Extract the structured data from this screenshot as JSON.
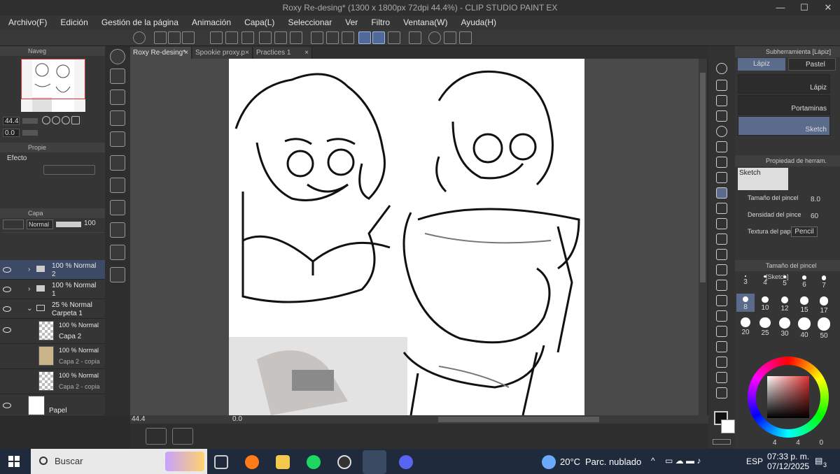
{
  "window": {
    "title": "Roxy Re-desing* (1300 x 1800px 72dpi 44.4%) - CLIP STUDIO PAINT EX",
    "minimize": "—",
    "maximize": "☐",
    "close": "✕"
  },
  "menu": [
    "Archivo(F)",
    "Edición",
    "Gestión de la página",
    "Animación",
    "Capa(L)",
    "Seleccionar",
    "Ver",
    "Filtro",
    "Ventana(W)",
    "Ayuda(H)"
  ],
  "navigator": {
    "tab_label": "Naveg",
    "zoom": "44.4",
    "rotation": "0.0"
  },
  "properties": {
    "tab_label": "Propie",
    "effect_label": "Efecto"
  },
  "layers": {
    "tab_label": "Capa",
    "blend_mode": "Normal",
    "opacity": "100",
    "items": [
      {
        "pct": "100 % Normal",
        "name": "2",
        "type": "folder",
        "selected": true
      },
      {
        "pct": "100 % Normal",
        "name": "1",
        "type": "folder",
        "selected": false
      },
      {
        "pct": "25 % Normal",
        "name": "Carpeta 1",
        "type": "folder-open",
        "selected": false
      },
      {
        "pct": "100 % Normal",
        "name": "Capa 2",
        "type": "layer",
        "selected": false
      },
      {
        "pct": "100 % Normal",
        "name": "Capa 2 - copia",
        "type": "layer",
        "selected": false
      },
      {
        "pct": "100 % Normal",
        "name": "Capa 2 - copia",
        "type": "layer",
        "selected": false
      },
      {
        "pct": "",
        "name": "Papel",
        "type": "paper",
        "selected": false
      }
    ]
  },
  "tabs": [
    {
      "label": "Roxy Re-desing*",
      "close": "×"
    },
    {
      "label": "Spookie proxy.p",
      "close": "×"
    },
    {
      "label": "Practices 1",
      "close": "×"
    }
  ],
  "canvas_status": {
    "zoom": "44.4",
    "rotation": "0.0"
  },
  "subtool": {
    "header": "Subherramienta [Lápiz]",
    "tab_pencil": "Lápiz",
    "tab_pastel": "Pastel",
    "brushes": [
      "Lápiz",
      "Portaminas",
      "Sketch"
    ]
  },
  "tool_property": {
    "header": "Propiedad de herram. [Sketc",
    "preview_label": "Sketch",
    "brush_size_label": "Tamaño del pincel",
    "brush_size_value": "8.0",
    "density_label": "Densidad del pince",
    "density_value": "60",
    "texture_label": "Textura del papel",
    "texture_value": "Pencil"
  },
  "brush_size_panel": {
    "header": "Tamaño del pincel [Sketch]",
    "sizes": [
      "3",
      "4",
      "5",
      "6",
      "7",
      "8",
      "10",
      "12",
      "15",
      "17",
      "20",
      "25",
      "30",
      "40",
      "50"
    ],
    "selected": "8"
  },
  "color": {
    "main": "#111111",
    "sub": "#ffffff",
    "wheel_values": [
      "4",
      "4",
      "0"
    ]
  },
  "taskbar": {
    "search_placeholder": "Buscar",
    "weather_temp": "20°C",
    "weather_desc": "Parc. nublado",
    "lang": "ESP",
    "time": "07:33 p. m.",
    "date": "07/12/2025",
    "notification_count": "3"
  }
}
